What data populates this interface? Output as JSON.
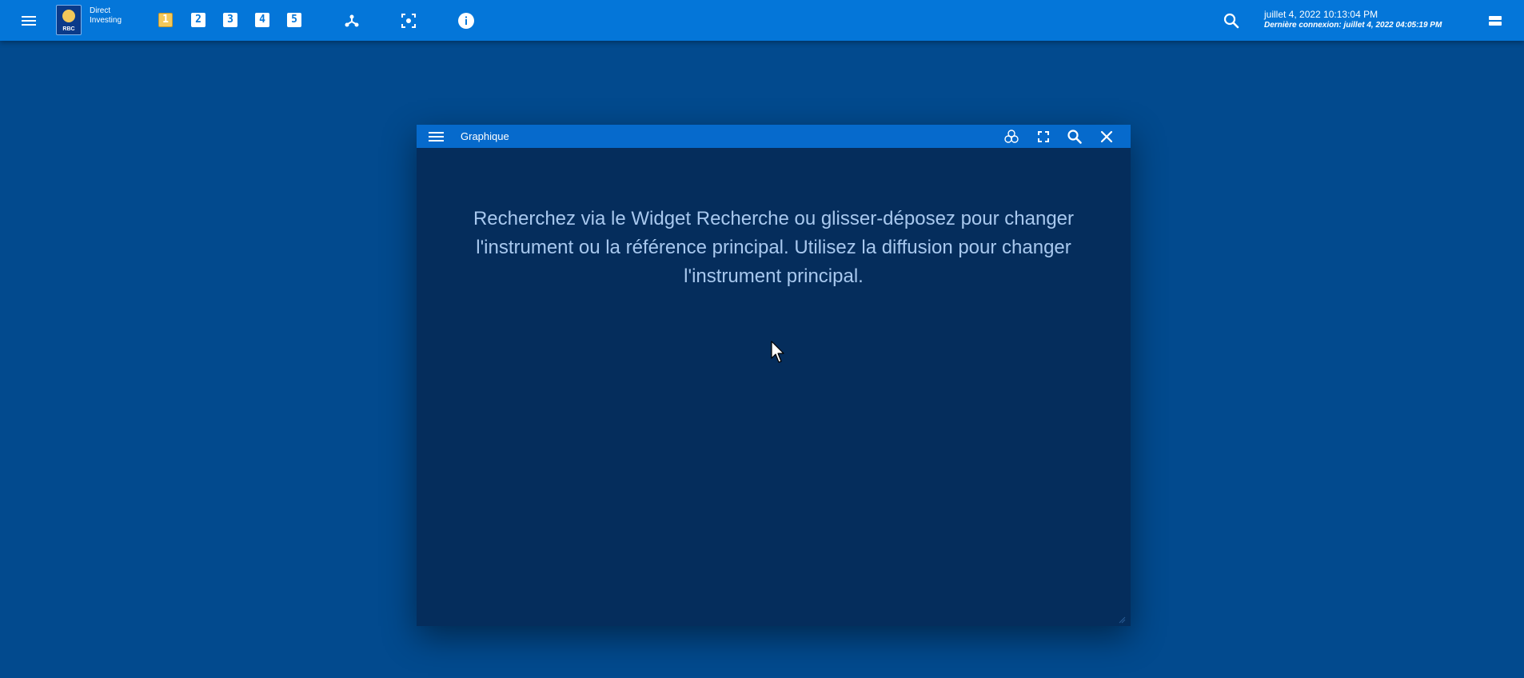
{
  "app": {
    "brand_line1": "Direct",
    "brand_line2": "Investing",
    "logo_text": "RBC",
    "colors": {
      "topbar": "#0476d9",
      "background": "#024a8e",
      "widget_body": "#052d5c",
      "widget_header": "#066acc",
      "active_workspace": "#f3c85a",
      "message_text": "#a8c8ee"
    }
  },
  "toolbar": {
    "menu_icon": "hamburger-menu-icon",
    "workspaces": [
      {
        "label": "1",
        "active": true
      },
      {
        "label": "2",
        "active": false
      },
      {
        "label": "3",
        "active": false
      },
      {
        "label": "4",
        "active": false
      },
      {
        "label": "5",
        "active": false
      }
    ],
    "icons": [
      "network-icon",
      "focus-icon",
      "info-icon",
      "search-icon",
      "layout-icon"
    ]
  },
  "session": {
    "datetime": "juillet 4, 2022 10:13:04 PM",
    "last_login": "Dernière connexion: juillet 4, 2022 04:05:19 PM"
  },
  "widget": {
    "title": "Graphique",
    "header_icons": [
      "hamburger-menu-icon",
      "link-channels-icon",
      "maximize-icon",
      "search-icon",
      "close-icon"
    ],
    "message": "Recherchez via le Widget Recherche ou glisser-déposez pour changer l'instrument ou la référence principal. Utilisez la diffusion pour changer l'instrument principal."
  }
}
